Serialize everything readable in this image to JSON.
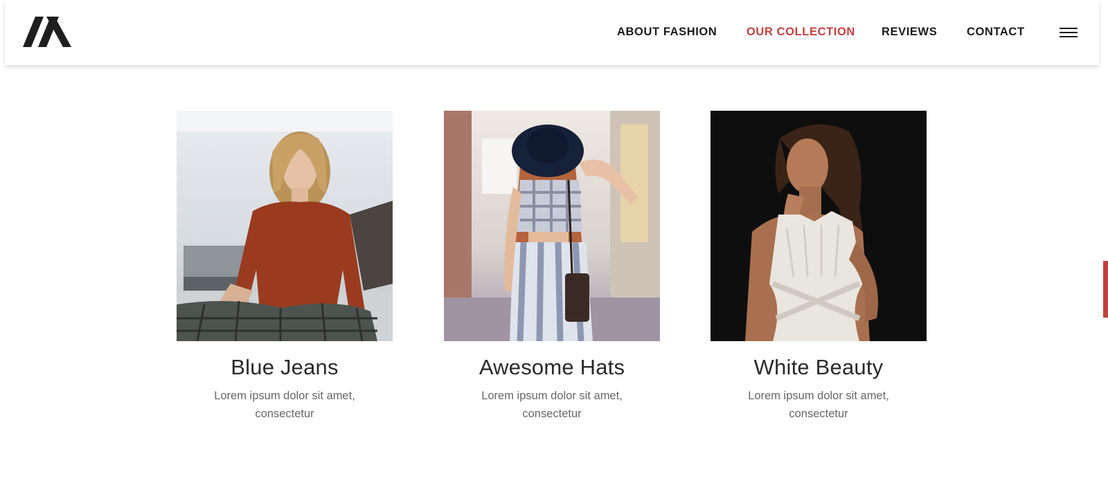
{
  "brand": {
    "logo": "logo-mark-icon"
  },
  "nav": {
    "items": [
      {
        "label": "ABOUT FASHION",
        "active": false
      },
      {
        "label": "OUR COLLECTION",
        "active": true
      },
      {
        "label": "REVIEWS",
        "active": false
      },
      {
        "label": "CONTACT",
        "active": false
      }
    ],
    "menu_icon": "hamburger-icon"
  },
  "collection": [
    {
      "title": "Blue Jeans",
      "desc": "Lorem ipsum dolor sit amet, consectetur"
    },
    {
      "title": "Awesome Hats",
      "desc": "Lorem ipsum dolor sit amet, consectetur"
    },
    {
      "title": "White Beauty",
      "desc": "Lorem ipsum dolor sit amet, consectetur"
    }
  ],
  "colors": {
    "accent": "#c1413f",
    "text": "#1b1b1b"
  }
}
